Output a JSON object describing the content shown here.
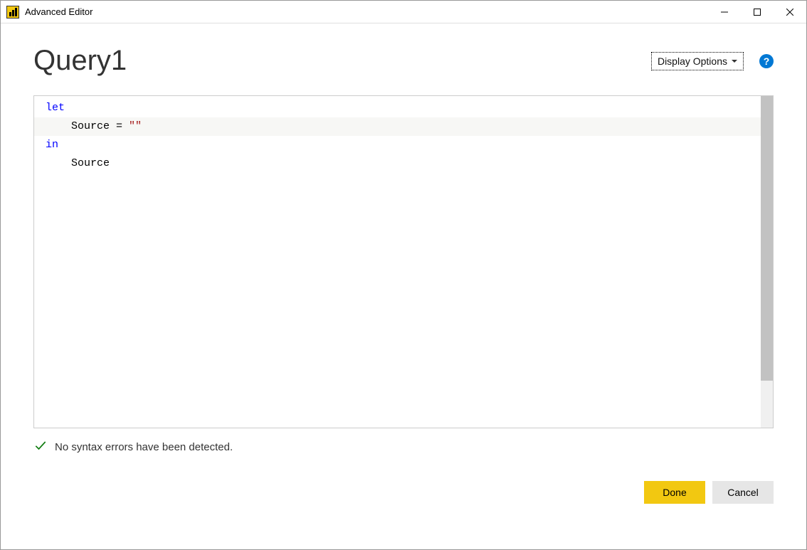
{
  "titlebar": {
    "title": "Advanced Editor"
  },
  "header": {
    "queryName": "Query1",
    "displayOptionsLabel": "Display Options"
  },
  "editor": {
    "code": {
      "line1_keyword": "let",
      "line2_indent": "    ",
      "line2_text": "Source = ",
      "line2_string": "\"\"",
      "line3_keyword": "in",
      "line4_indent": "    ",
      "line4_text": "Source"
    }
  },
  "status": {
    "message": "No syntax errors have been detected."
  },
  "footer": {
    "doneLabel": "Done",
    "cancelLabel": "Cancel"
  }
}
